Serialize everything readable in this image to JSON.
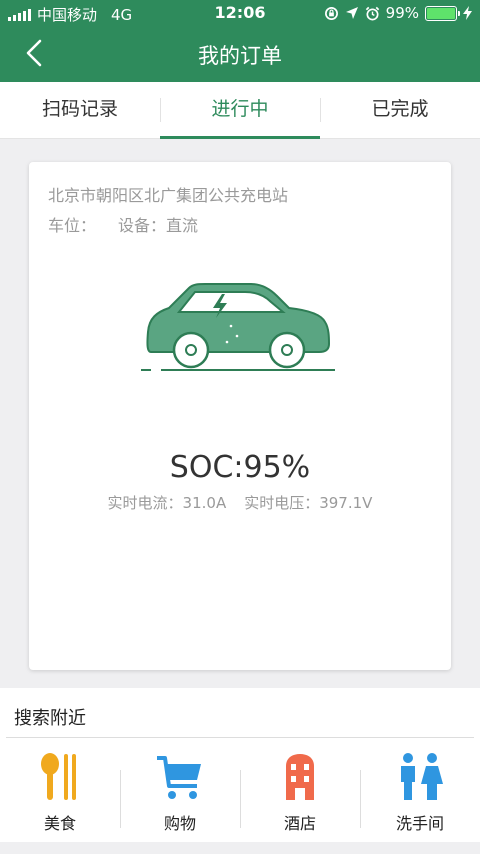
{
  "status_bar": {
    "carrier": "中国移动",
    "network": "4G",
    "time": "12:06",
    "battery": "99%"
  },
  "header": {
    "title": "我的订单",
    "back_icon": "chevron-left-icon"
  },
  "tabs": [
    {
      "label": "扫码记录",
      "active": false
    },
    {
      "label": "进行中",
      "active": true
    },
    {
      "label": "已完成",
      "active": false
    }
  ],
  "order": {
    "station": "北京市朝阳区北广集团公共充电站",
    "spot_label": "车位：",
    "device_label": "设备：直流",
    "soc": "SOC:95%",
    "current": "实时电流：31.0A",
    "voltage": "实时电压：397.1V"
  },
  "nearby": {
    "title": "搜索附近",
    "items": [
      {
        "label": "美食",
        "icon": "food-icon",
        "color": "#f0a91e"
      },
      {
        "label": "购物",
        "icon": "shopping-cart-icon",
        "color": "#2f96e0"
      },
      {
        "label": "酒店",
        "icon": "hotel-icon",
        "color": "#f06a4b"
      },
      {
        "label": "洗手间",
        "icon": "restroom-icon",
        "color": "#2f96e0"
      }
    ]
  },
  "colors": {
    "brand": "#2e8b5c",
    "car_fill": "#5aa582"
  }
}
